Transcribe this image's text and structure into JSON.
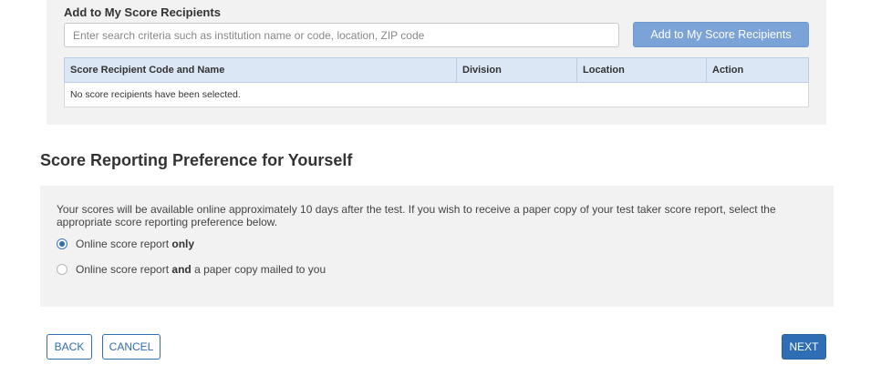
{
  "recipients": {
    "heading": "Add to My Score Recipients",
    "search_placeholder": "Enter search criteria such as institution name or code, location, ZIP code",
    "add_button_label": "Add to My Score Recipients",
    "table": {
      "columns": [
        "Score Recipient Code and Name",
        "Division",
        "Location",
        "Action"
      ],
      "empty_message": "No score recipients have been selected."
    }
  },
  "preference": {
    "title": "Score Reporting Preference for Yourself",
    "description": "Your scores will be available online approximately 10 days after the test. If you wish to receive a paper copy of your test taker score report, select the appropriate score reporting preference below.",
    "options": [
      {
        "label_prefix": "Online score report ",
        "label_bold": "only",
        "label_suffix": "",
        "selected": true
      },
      {
        "label_prefix": "Online score report ",
        "label_bold": "and",
        "label_suffix": " a paper copy mailed to you",
        "selected": false
      }
    ]
  },
  "navigation": {
    "back_label": "BACK",
    "cancel_label": "CANCEL",
    "next_label": "NEXT"
  },
  "colors": {
    "primary": "#2f6db5",
    "add_button": "#7ba3d8",
    "panel_bg": "#f2f2f3",
    "table_header_bg": "#dbe7f5"
  }
}
